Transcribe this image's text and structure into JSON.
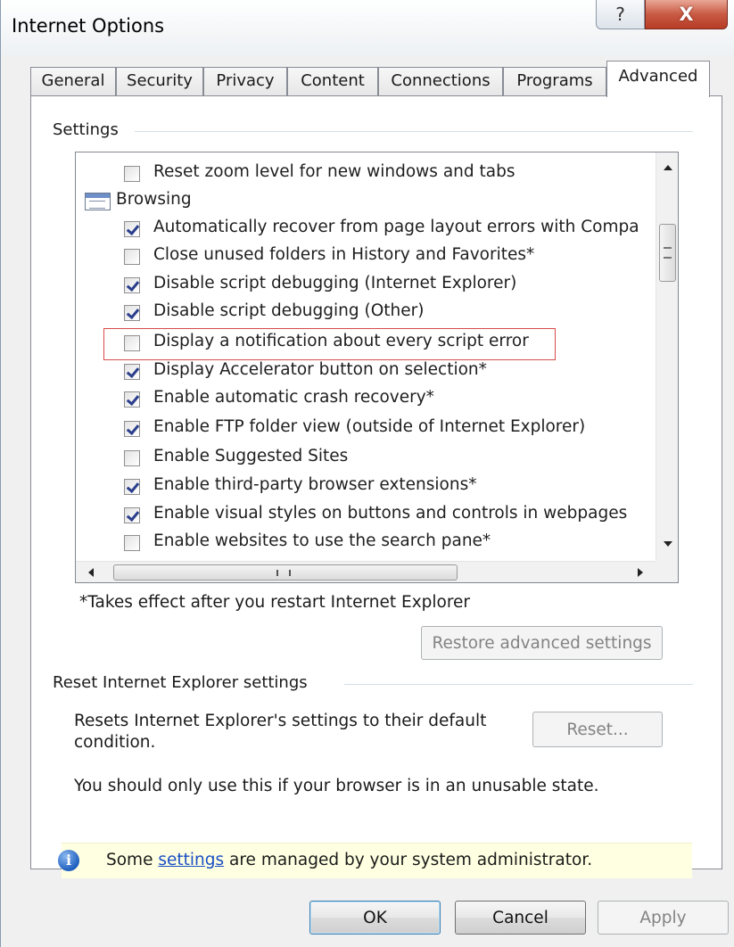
{
  "window": {
    "title": "Internet Options",
    "help_label": "?",
    "close_label": "X"
  },
  "tabs": [
    {
      "label": "General",
      "active": false
    },
    {
      "label": "Security",
      "active": false
    },
    {
      "label": "Privacy",
      "active": false
    },
    {
      "label": "Content",
      "active": false
    },
    {
      "label": "Connections",
      "active": false
    },
    {
      "label": "Programs",
      "active": false
    },
    {
      "label": "Advanced",
      "active": true
    }
  ],
  "settings": {
    "group_label": "Settings",
    "items": [
      {
        "type": "checkbox",
        "label": "Reset zoom level for new windows and tabs",
        "checked": false
      },
      {
        "type": "group",
        "label": "Browsing",
        "icon": "settings-group-icon"
      },
      {
        "type": "checkbox",
        "label": "Automatically recover from page layout errors with Compa",
        "checked": true
      },
      {
        "type": "checkbox",
        "label": "Close unused folders in History and Favorites*",
        "checked": false
      },
      {
        "type": "checkbox",
        "label": "Disable script debugging (Internet Explorer)",
        "checked": true
      },
      {
        "type": "checkbox",
        "label": "Disable script debugging (Other)",
        "checked": true
      },
      {
        "type": "checkbox",
        "label": "Display a notification about every script error",
        "checked": false,
        "highlighted": true
      },
      {
        "type": "checkbox",
        "label": "Display Accelerator button on selection*",
        "checked": true
      },
      {
        "type": "checkbox",
        "label": "Enable automatic crash recovery*",
        "checked": true
      },
      {
        "type": "checkbox",
        "label": "Enable FTP folder view (outside of Internet Explorer)",
        "checked": true
      },
      {
        "type": "checkbox",
        "label": "Enable Suggested Sites",
        "checked": false
      },
      {
        "type": "checkbox",
        "label": "Enable third-party browser extensions*",
        "checked": true
      },
      {
        "type": "checkbox",
        "label": "Enable visual styles on buttons and controls in webpages",
        "checked": true
      },
      {
        "type": "checkbox",
        "label": "Enable websites to use the search pane*",
        "checked": false
      }
    ],
    "restart_note": "*Takes effect after you restart Internet Explorer",
    "restore_button": "Restore advanced settings",
    "hscroll_grip": "III"
  },
  "reset": {
    "group_label": "Reset Internet Explorer settings",
    "description": "Resets Internet Explorer's settings to their default condition.",
    "button": "Reset...",
    "warning": "You should only use this if your browser is in an unusable state."
  },
  "info_bar": {
    "prefix": "Some ",
    "link": "settings",
    "suffix": " are managed by your system administrator.",
    "icon": "info-icon"
  },
  "footer": {
    "ok": "OK",
    "cancel": "Cancel",
    "apply": "Apply"
  },
  "colors": {
    "highlight_border": "#d84a4a",
    "info_bar_bg": "#ffffe1",
    "link": "#1a4fc4",
    "check_mark": "#2a3e8c"
  }
}
